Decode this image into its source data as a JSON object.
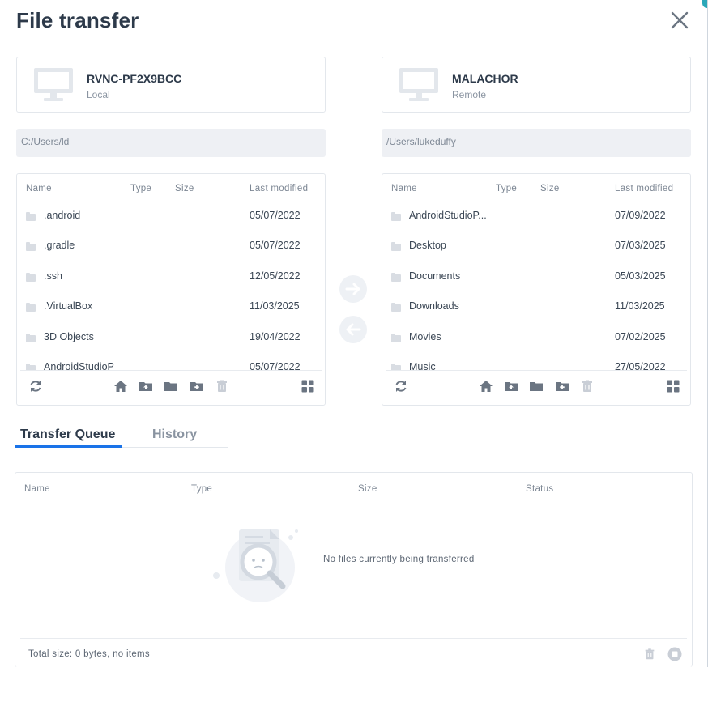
{
  "dialog": {
    "title": "File transfer"
  },
  "local": {
    "machine_name": "RVNC-PF2X9BCC",
    "role": "Local",
    "path": "C:/Users/ld",
    "columns": {
      "name": "Name",
      "type": "Type",
      "size": "Size",
      "modified": "Last modified"
    },
    "files": [
      {
        "name": ".android",
        "modified": "05/07/2022"
      },
      {
        "name": ".gradle",
        "modified": "05/07/2022"
      },
      {
        "name": ".ssh",
        "modified": "12/05/2022"
      },
      {
        "name": ".VirtualBox",
        "modified": "11/03/2025"
      },
      {
        "name": "3D Objects",
        "modified": "19/04/2022"
      },
      {
        "name": "AndroidStudioP",
        "modified": "05/07/2022"
      }
    ]
  },
  "remote": {
    "machine_name": "MALACHOR",
    "role": "Remote",
    "path": "/Users/lukeduffy",
    "columns": {
      "name": "Name",
      "type": "Type",
      "size": "Size",
      "modified": "Last modified"
    },
    "files": [
      {
        "name": "AndroidStudioP...",
        "modified": "07/09/2022"
      },
      {
        "name": "Desktop",
        "modified": "07/03/2025"
      },
      {
        "name": "Documents",
        "modified": "05/03/2025"
      },
      {
        "name": "Downloads",
        "modified": "11/03/2025"
      },
      {
        "name": "Movies",
        "modified": "07/02/2025"
      },
      {
        "name": "Music",
        "modified": "27/05/2022"
      }
    ]
  },
  "tabs": [
    {
      "label": "Transfer Queue",
      "active": true
    },
    {
      "label": "History",
      "active": false
    }
  ],
  "queue": {
    "columns": {
      "name": "Name",
      "type": "Type",
      "size": "Size",
      "status": "Status"
    },
    "empty_message": "No files currently being transferred",
    "total": "Total size: 0 bytes, no items"
  },
  "icons": {
    "close": "close-icon",
    "monitor": "monitor-icon",
    "folder": "folder-icon",
    "refresh": "refresh-icon",
    "home": "home-icon",
    "upload": "upload-folder-icon",
    "open": "open-folder-icon",
    "add": "new-folder-icon",
    "trash": "trash-icon",
    "grid": "grid-view-icon",
    "arrow_right": "arrow-right-icon",
    "arrow_left": "arrow-left-icon",
    "stop": "stop-icon",
    "empty": "empty-search-illustration"
  },
  "colors": {
    "accent": "#1a73e8",
    "icon": "#6b7582",
    "icon_disabled": "#c9ced6",
    "text": "#2d3a4a"
  }
}
